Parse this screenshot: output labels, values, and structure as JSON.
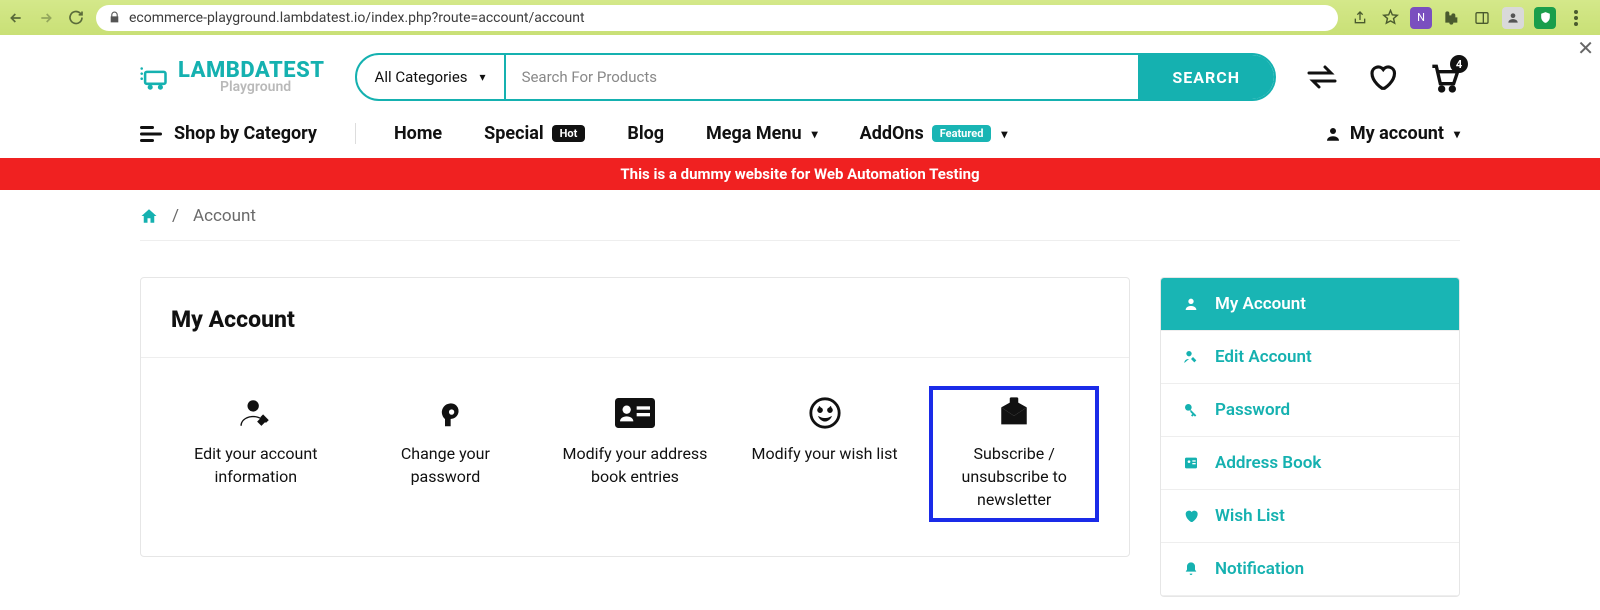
{
  "browser": {
    "url": "ecommerce-playground.lambdatest.io/index.php?route=account/account"
  },
  "logo": {
    "line1": "LAMBDATEST",
    "line2": "Playground"
  },
  "search": {
    "category": "All Categories",
    "placeholder": "Search For Products",
    "button": "SEARCH"
  },
  "cart_count": "4",
  "nav": {
    "shop_by_category": "Shop by Category",
    "items": [
      {
        "label": "Home"
      },
      {
        "label": "Special",
        "pill": "Hot",
        "pill_class": "pill-hot"
      },
      {
        "label": "Blog"
      },
      {
        "label": "Mega Menu",
        "caret": true
      },
      {
        "label": "AddOns",
        "pill": "Featured",
        "pill_class": "pill-feat",
        "caret": true
      }
    ],
    "account": "My account"
  },
  "banner": "This is a dummy website for Web Automation Testing",
  "breadcrumb": {
    "current": "Account"
  },
  "card": {
    "title": "My Account",
    "tiles": [
      {
        "label": "Edit your account information"
      },
      {
        "label": "Change your password"
      },
      {
        "label": "Modify your address book entries"
      },
      {
        "label": "Modify your wish list"
      },
      {
        "label": "Subscribe / unsubscribe to newsletter",
        "highlight": true
      }
    ]
  },
  "sidebar": [
    {
      "label": "My Account",
      "active": true,
      "icon": "user"
    },
    {
      "label": "Edit Account",
      "icon": "user-edit"
    },
    {
      "label": "Password",
      "icon": "key"
    },
    {
      "label": "Address Book",
      "icon": "address"
    },
    {
      "label": "Wish List",
      "icon": "heart"
    },
    {
      "label": "Notification",
      "icon": "bell"
    }
  ]
}
